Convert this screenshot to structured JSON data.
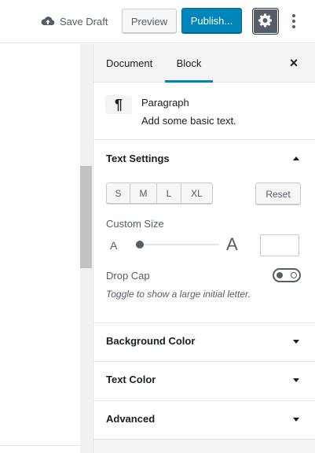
{
  "toolbar": {
    "save_draft": "Save Draft",
    "preview": "Preview",
    "publish": "Publish..."
  },
  "sidebar": {
    "tabs": [
      {
        "label": "Document",
        "active": false
      },
      {
        "label": "Block",
        "active": true
      }
    ],
    "close": "×",
    "block": {
      "icon": "¶",
      "title": "Paragraph",
      "description": "Add some basic text."
    },
    "text_settings": {
      "title": "Text Settings",
      "sizes": [
        "S",
        "M",
        "L",
        "XL"
      ],
      "reset": "Reset",
      "custom_size_label": "Custom Size",
      "small_a": "A",
      "large_a": "A",
      "custom_size_value": "",
      "drop_cap_label": "Drop Cap",
      "drop_cap_help": "Toggle to show a large initial letter.",
      "drop_cap_enabled": false
    },
    "panels": [
      {
        "title": "Background Color",
        "open": false
      },
      {
        "title": "Text Color",
        "open": false
      },
      {
        "title": "Advanced",
        "open": false
      }
    ]
  },
  "colors": {
    "accent": "#0085ba",
    "settings_button": "#555d66"
  },
  "icons": {
    "save_draft": "cloud-upload-icon",
    "settings": "gear-icon",
    "more": "vertical-ellipsis-icon",
    "close": "close-icon",
    "block": "paragraph-icon"
  }
}
